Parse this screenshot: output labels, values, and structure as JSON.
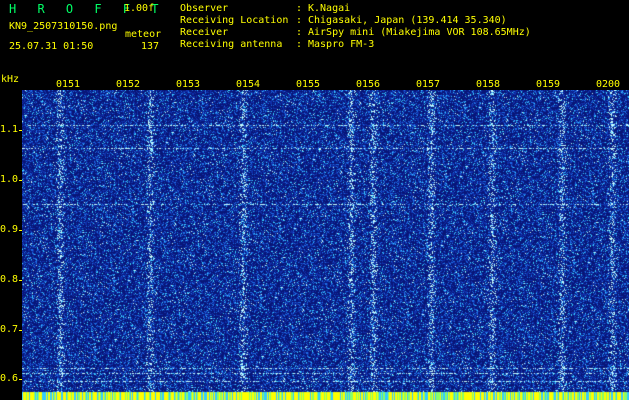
{
  "header": {
    "app_title": "H R O F F T",
    "version": "1.00f",
    "filename": "KN9_2507310150.png",
    "meteor_label": "meteor",
    "timestamp": "25.07.31 01:50",
    "count": "137",
    "meta": [
      {
        "label": "Observer",
        "value": "K.Nagai"
      },
      {
        "label": "Receiving Location",
        "value": "Chigasaki, Japan (139.414 35.340)"
      },
      {
        "label": "Receiver",
        "value": "AirSpy mini (Miakejima VOR 108.65MHz)"
      },
      {
        "label": "Receiving antenna",
        "value": "Maspro FM-3"
      }
    ]
  },
  "axis": {
    "unit": "kHz",
    "y_ticks": [
      "1.1",
      "1.0",
      "0.9",
      "0.8",
      "0.7",
      "0.6"
    ],
    "x_ticks": [
      "0151",
      "0152",
      "0153",
      "0154",
      "0155",
      "0156",
      "0157",
      "0158",
      "0159",
      "0200"
    ]
  },
  "colors": {
    "text": "#ffff00",
    "title": "#00ff66",
    "background": "#000000",
    "noise_base": "#0a1a8c",
    "noise_light": "#33ccff",
    "signal_line": "#66ffff",
    "bottom_band": "#ffff00"
  }
}
